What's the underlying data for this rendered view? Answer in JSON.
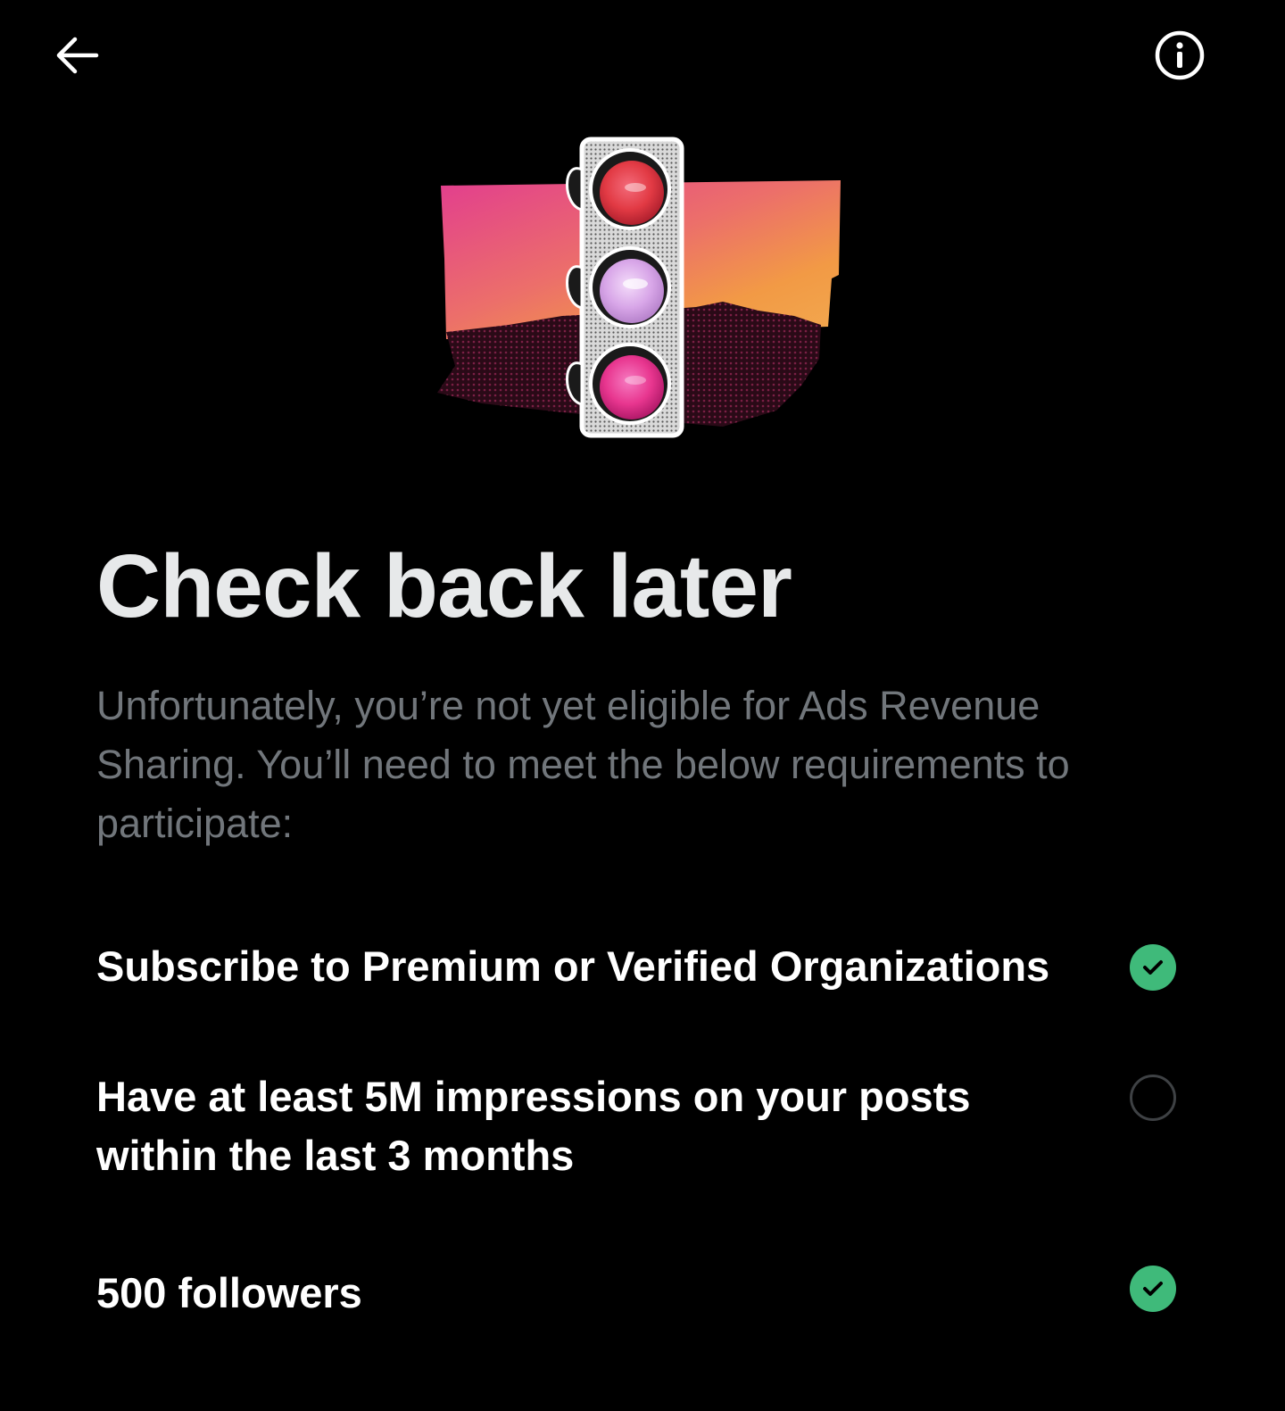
{
  "header": {
    "back_icon": "arrow-left-icon",
    "info_icon": "info-circle-icon"
  },
  "hero": {
    "illustration": "traffic-light-illustration",
    "colors": {
      "pink": "#e83e8c",
      "orange": "#f2a03d",
      "dark_red": "#3a0f1e",
      "light_red": "#e23a44",
      "light_lilac": "#d8a6e8",
      "light_magenta": "#e8368f"
    }
  },
  "main": {
    "title": "Check back later",
    "description": "Unfortunately, you’re not yet eligible for Ads Revenue Sharing. You’ll need to meet the below requirements to participate:"
  },
  "requirements": [
    {
      "label": "Subscribe to Premium or Verified Organizations",
      "met": true
    },
    {
      "label": "Have at least 5M impressions on your posts within the last 3 months",
      "met": false
    },
    {
      "label": "500 followers",
      "met": true
    }
  ],
  "colors": {
    "background": "#000000",
    "title": "#e7e9ea",
    "secondary_text": "#71767b",
    "success": "#3fba7a",
    "pending_ring": "#3e4144"
  }
}
